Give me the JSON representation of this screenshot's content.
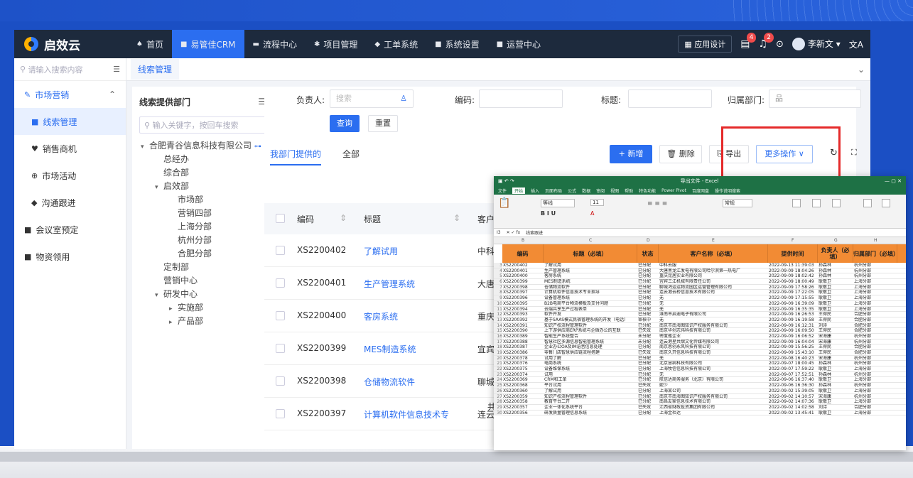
{
  "brand": "启效云",
  "nav": {
    "items": [
      {
        "icon": "home-icon",
        "glyph": "♠",
        "label": "首页"
      },
      {
        "icon": "crm-icon",
        "glyph": "■",
        "label": "易管佳CRM",
        "active": true
      },
      {
        "icon": "flow-icon",
        "glyph": "▬",
        "label": "流程中心"
      },
      {
        "icon": "project-icon",
        "glyph": "✱",
        "label": "项目管理"
      },
      {
        "icon": "ticket-icon",
        "glyph": "◆",
        "label": "工单系统"
      },
      {
        "icon": "settings-icon",
        "glyph": "■",
        "label": "系统设置"
      },
      {
        "icon": "ops-icon",
        "glyph": "■",
        "label": "运营中心"
      }
    ],
    "app_design": "应用设计",
    "badge_doc": "4",
    "badge_bell": "2",
    "user": "李新文"
  },
  "sidebar": {
    "search_placeholder": "请输入搜索内容",
    "items": [
      {
        "label": "市场营销",
        "kind": "group"
      },
      {
        "label": "线索管理",
        "kind": "selected"
      },
      {
        "label": "销售商机",
        "kind": "sub"
      },
      {
        "label": "市场活动",
        "kind": "sub"
      },
      {
        "label": "沟通跟进",
        "kind": "sub"
      },
      {
        "label": "会议室预定",
        "kind": "top"
      },
      {
        "label": "物资领用",
        "kind": "top"
      }
    ]
  },
  "tab": {
    "label": "线索管理"
  },
  "tree": {
    "title": "线索提供部门",
    "search_placeholder": "输入关键字，按回车搜索",
    "nodes": [
      {
        "label": "合肥青谷信息科技有限公司",
        "level": 0,
        "toggle": "▾"
      },
      {
        "label": "总经办",
        "level": 1,
        "toggle": ""
      },
      {
        "label": "综合部",
        "level": 1,
        "toggle": ""
      },
      {
        "label": "启效部",
        "level": 1,
        "toggle": "▾"
      },
      {
        "label": "市场部",
        "level": 2,
        "toggle": ""
      },
      {
        "label": "营销四部",
        "level": 2,
        "toggle": ""
      },
      {
        "label": "上海分部",
        "level": 2,
        "toggle": ""
      },
      {
        "label": "杭州分部",
        "level": 2,
        "toggle": ""
      },
      {
        "label": "合肥分部",
        "level": 2,
        "toggle": ""
      },
      {
        "label": "定制部",
        "level": 1,
        "toggle": ""
      },
      {
        "label": "营销中心",
        "level": 1,
        "toggle": ""
      },
      {
        "label": "研发中心",
        "level": 1,
        "toggle": "▾"
      },
      {
        "label": "实施部",
        "level": 2,
        "toggle": "▸"
      },
      {
        "label": "产品部",
        "level": 2,
        "toggle": "▸"
      }
    ]
  },
  "filters": {
    "owner_label": "负责人:",
    "owner_placeholder": "搜索",
    "code_label": "编码:",
    "title_label": "标题:",
    "dept_label": "归属部门:",
    "query": "查询",
    "reset": "重置"
  },
  "subtabs": {
    "mine": "我部门提供的",
    "all": "全部"
  },
  "actions": {
    "add": "+ 新增",
    "delete": "删除",
    "export": "导出",
    "more": "更多操作 ∨"
  },
  "table": {
    "headers": {
      "code": "编码",
      "title": "标题",
      "customer": "客户"
    },
    "rows": [
      {
        "code": "XS2200402",
        "title": "了解试用",
        "customer": "中科"
      },
      {
        "code": "XS2200401",
        "title": "生产管理系统",
        "customer": "大唐"
      },
      {
        "code": "XS2200400",
        "title": "客房系统",
        "customer": "重庆"
      },
      {
        "code": "XS2200399",
        "title": "MES制造系统",
        "customer": "宜宾"
      },
      {
        "code": "XS2200398",
        "title": "仓储物流软件",
        "customer": "聊城"
      },
      {
        "code": "XS2200397",
        "title": "计算机软件信息技术专",
        "customer": "连云"
      }
    ],
    "footer_fragment": "共"
  },
  "excel": {
    "title": "导出文件 - Excel",
    "menu": [
      "文件",
      "开始",
      "插入",
      "页面布局",
      "公式",
      "数据",
      "审阅",
      "视图",
      "帮助",
      "特色功能",
      "Power Pivot",
      "百度网盘",
      "操作说明搜索"
    ],
    "cell_ref": "I3",
    "formula": "线索跟进",
    "font_name": "等线",
    "font_size": "11",
    "col_letters": [
      "B",
      "C",
      "D",
      "E",
      "F",
      "G",
      "H"
    ],
    "headers": [
      "编码",
      "标题（必填）",
      "状态",
      "客户名称（必填）",
      "提供时间",
      "负责人（必填）",
      "归属部门（必填）"
    ],
    "rows": [
      [
        "3",
        "XS2200402",
        "了解试用",
        "已分配",
        "中科云服",
        "2022-09-13 11:39:03",
        "孙森林",
        "杭州分部"
      ],
      [
        "4",
        "XS2200401",
        "生产管理系统",
        "已分配",
        "大唐黑龙江发电有限公司哈尔滨第一热电厂",
        "2022-09-09 18:04:26",
        "孙森林",
        "杭州分部"
      ],
      [
        "5",
        "XS2200400",
        "客房系统",
        "已分配",
        "重庆昆居实业有限公司",
        "2022-09-09 18:02:42",
        "孙森林",
        "杭州分部"
      ],
      [
        "6",
        "XS2200399",
        "MES制造系统",
        "已分配",
        "宜宾三江机械有限责任公司",
        "2022-09-09 18:00:49",
        "耿敬卫",
        "上海分部"
      ],
      [
        "7",
        "XS2200398",
        "仓储物流软件",
        "已分配",
        "聊城鸿运运物流园区运营管理有限公司",
        "2022-09-09 17:58:26",
        "耿敬卫",
        "上海分部"
      ],
      [
        "8",
        "XS2200397",
        "计算机软件信息技术专业指导",
        "已分配",
        "连云港云桥信息技术有限公司",
        "2022-09-09 17:22:05",
        "耿敬卫",
        "上海分部"
      ],
      [
        "9",
        "XS2200396",
        "设备管理系统",
        "已分配",
        "无",
        "2022-09-09 17:15:55",
        "耿敬卫",
        "上海分部"
      ],
      [
        "10",
        "XS2200395",
        "B2B电商平台物流模板及支付问题",
        "已分配",
        "无",
        "2022-09-09 16:39:09",
        "耿敬卫",
        "上海分部"
      ],
      [
        "11",
        "XS2200394",
        "云端共享生产过程表单",
        "已分配",
        "无",
        "2022-09-09 16:35:35",
        "耿敬卫",
        "上海分部"
      ],
      [
        "12",
        "XS2200393",
        "软件开发",
        "已分配",
        "淮南市启迪电子有限公司",
        "2022-09-09 16:26:53",
        "王得民",
        "合肥分部"
      ],
      [
        "13",
        "XS2200392",
        "基于SAAS模式民宿管理系统的开发（电话）",
        "审核中",
        "无",
        "2022-09-09 16:19:58",
        "王得民",
        "合肥分部"
      ],
      [
        "14",
        "XS2200391",
        "知识产权流程管理软件",
        "已分配",
        "南京市南海图知识产权服务有限公司",
        "2022-09-09 16:12:31",
        "刘诗",
        "合肥分部"
      ],
      [
        "15",
        "XS2200390",
        "上下游供应商ERP系统与企微办公的互联",
        "已失效",
        "南京华创志伟科技有限公司",
        "2022-09-09 16:09:50",
        "王得民",
        "合肥分部"
      ],
      [
        "16",
        "XS2200389",
        "智能生产系统整合",
        "未分配",
        "密度瓶企业",
        "2022-09-09 16:06:52",
        "宋海康",
        "杭州分部"
      ],
      [
        "17",
        "XS2200388",
        "智慧社区多源信息智能管理系统",
        "未分配",
        "连云港星共熠文化传媒有限公司",
        "2022-09-09 16:04:04",
        "宋海康",
        "杭州分部"
      ],
      [
        "18",
        "XS2200387",
        "企业办公OA及IM语音信息处理",
        "已分配",
        "南京思创永风科技有限公司",
        "2022-09-09 15:56:25",
        "王得民",
        "合肥分部"
      ],
      [
        "19",
        "XS2200386",
        "零售门店智慧供应链流程搭建",
        "已失效",
        "南京久开信息科技有限公司",
        "2022-09-09 15:43:10",
        "王得民",
        "合肥分部"
      ],
      [
        "20",
        "XS2200378",
        "试用了解",
        "已分配",
        "无",
        "2022-09-08 16:40:23",
        "宋海康",
        "杭州分部"
      ],
      [
        "21",
        "XS2200376",
        "电商系统",
        "已分配",
        "北京慧纳科技有限公司",
        "2022-09-07 18:00:45",
        "孙森林",
        "杭州分部"
      ],
      [
        "22",
        "XS2200375",
        "设备维保系统",
        "已分配",
        "上海牧信信息科技有限公司",
        "2022-09-07 17:59:22",
        "耿敬卫",
        "上海分部"
      ],
      [
        "23",
        "XS2200374",
        "试用",
        "已分配",
        "无",
        "2022-09-07 17:52:51",
        "孙森林",
        "杭州分部"
      ],
      [
        "24",
        "XS2200369",
        "CRM和工单",
        "已分配",
        "航信达商务服务（北京）有限公司",
        "2022-09-06 16:37:40",
        "耿敬卫",
        "上海分部"
      ],
      [
        "25",
        "XS2200368",
        "平台试用",
        "已失效",
        "妮少",
        "2022-09-06 16:36:30",
        "孙森林",
        "杭州分部"
      ],
      [
        "26",
        "XS2200360",
        "了解试用",
        "已分配",
        "上海某公司",
        "2022-09-02 15:39:05",
        "耿敬卫",
        "上海分部"
      ],
      [
        "27",
        "XS2200359",
        "知识产权流程管理软件",
        "已分配",
        "南京市南海图知识产权服务有限公司",
        "2022-09-02 14:10:57",
        "宋海康",
        "杭州分部"
      ],
      [
        "28",
        "XS2200358",
        "教育平台二开",
        "已分配",
        "南昌友家信息技术有限公司",
        "2022-09-02 14:07:36",
        "耿敬卫",
        "上海分部"
      ],
      [
        "29",
        "XS2200357",
        "企业一体化系统平台",
        "已失效",
        "江西省财政投资集团有限公司",
        "2022-09-02 14:02:58",
        "刘诗",
        "合肥分部"
      ],
      [
        "30",
        "XS2200356",
        "研发质量管理信息系统",
        "已分配",
        "上海金杜达",
        "2022-09-02 13:45:41",
        "耿敬卫",
        "上海分部"
      ]
    ]
  }
}
